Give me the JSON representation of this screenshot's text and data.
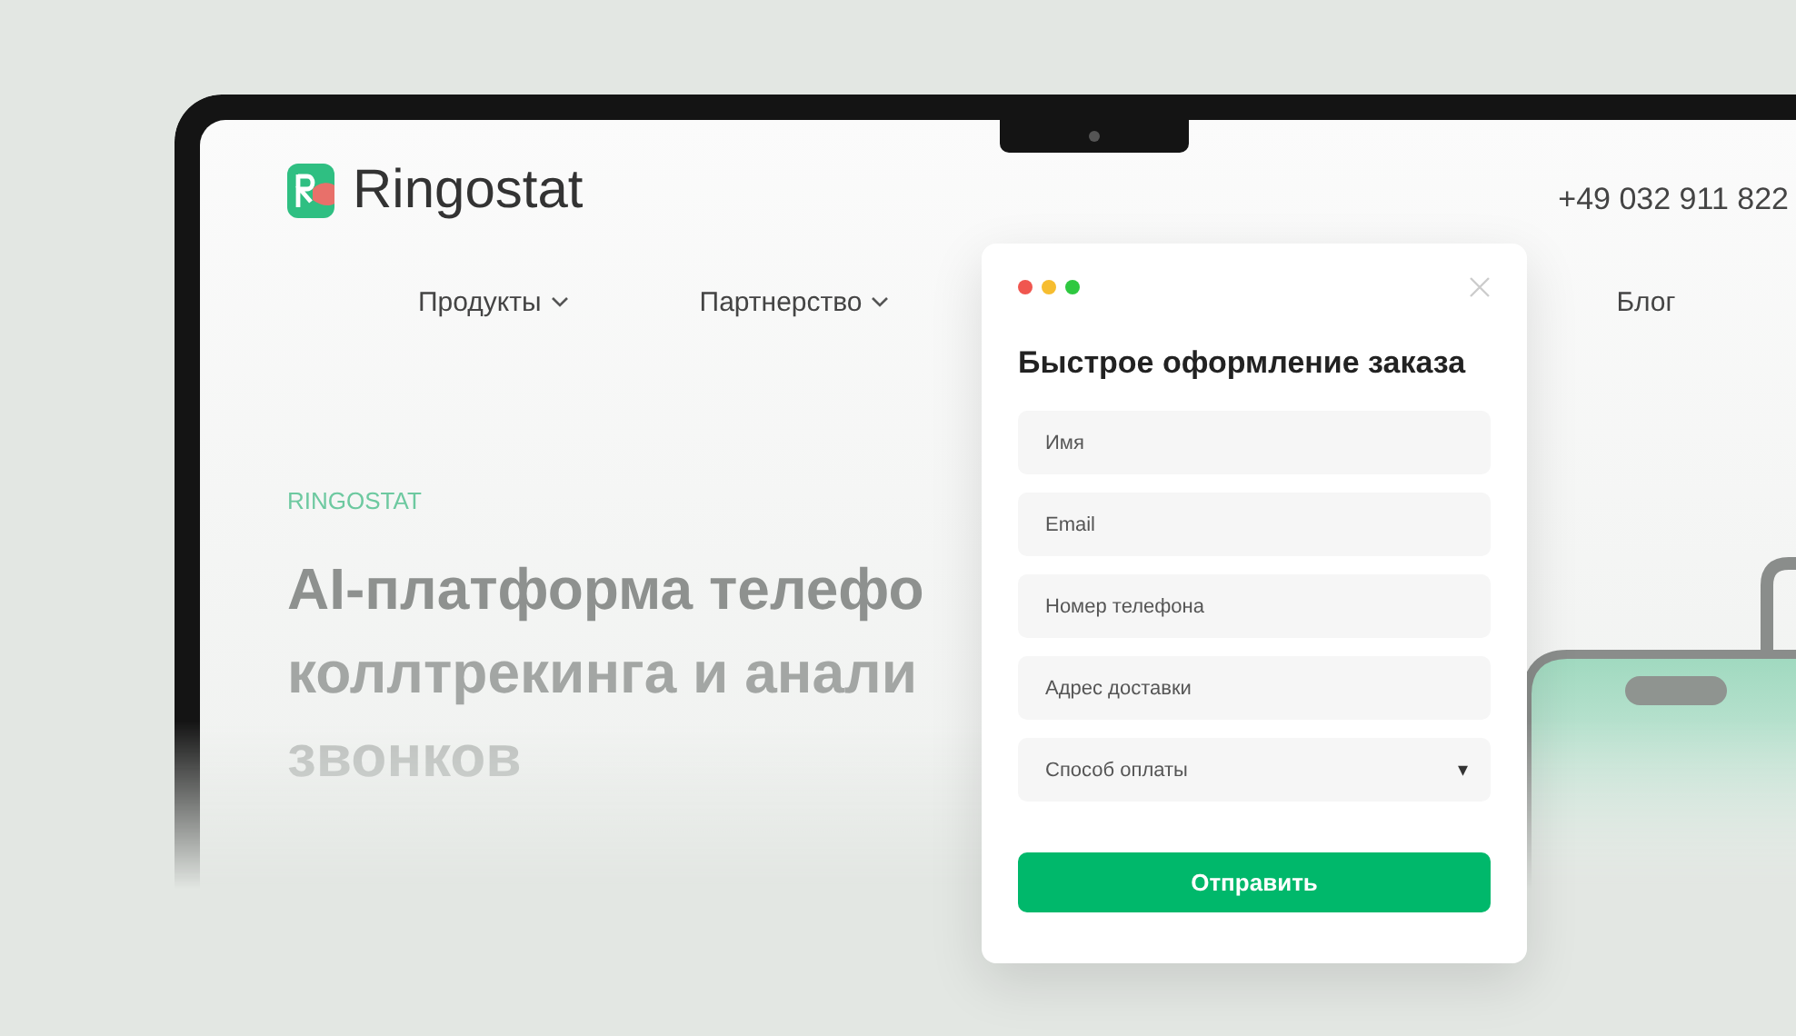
{
  "site": {
    "logo_text": "Ringostat",
    "phone": "+49 032 911 822",
    "nav": [
      {
        "label": "Продукты",
        "dropdown": true
      },
      {
        "label": "Партнерство",
        "dropdown": true
      },
      {
        "label": "Блог",
        "dropdown": false
      }
    ],
    "hero": {
      "eyebrow": "RINGOSTAT",
      "title_lines": [
        "AI-платформа телефо",
        "коллтрекинга и анали",
        "звонков"
      ]
    }
  },
  "modal": {
    "title": "Быстрое оформление заказа",
    "fields": [
      {
        "kind": "text",
        "placeholder": "Имя"
      },
      {
        "kind": "text",
        "placeholder": "Email"
      },
      {
        "kind": "text",
        "placeholder": "Номер телефона"
      },
      {
        "kind": "text",
        "placeholder": "Адрес доставки"
      },
      {
        "kind": "select",
        "placeholder": "Способ оплаты",
        "caret": "▾"
      }
    ],
    "submit": "Отправить"
  }
}
